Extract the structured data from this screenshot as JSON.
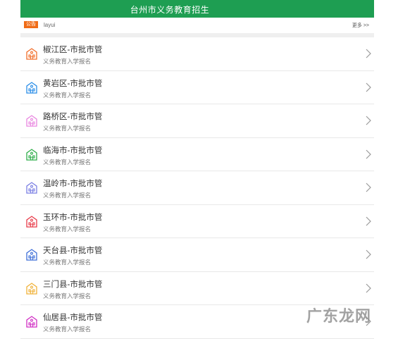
{
  "header": {
    "title": "台州市义务教育招生"
  },
  "notice": {
    "tag": "公告",
    "text": "layui",
    "more": "更多 >>"
  },
  "items": [
    {
      "name": "椒江区-市批市管",
      "sub": "义务教育入学报名",
      "color": "#f26f2b"
    },
    {
      "name": "黄岩区-市批市管",
      "sub": "义务教育入学报名",
      "color": "#2b8ee8"
    },
    {
      "name": "路桥区-市批市管",
      "sub": "义务教育入学报名",
      "color": "#e987e0"
    },
    {
      "name": "临海市-市批市管",
      "sub": "义务教育入学报名",
      "color": "#2fae4a"
    },
    {
      "name": "温岭市-市批市管",
      "sub": "义务教育入学报名",
      "color": "#7b7fe3"
    },
    {
      "name": "玉环市-市批市管",
      "sub": "义务教育入学报名",
      "color": "#e83c4a"
    },
    {
      "name": "天台县-市批市管",
      "sub": "义务教育入学报名",
      "color": "#3e6fd8"
    },
    {
      "name": "三门县-市批市管",
      "sub": "义务教育入学报名",
      "color": "#f0b23a"
    },
    {
      "name": "仙居县-市批市管",
      "sub": "义务教育入学报名",
      "color": "#d12fc4"
    }
  ],
  "watermark": {
    "text": "广东龙网"
  },
  "icons": {
    "item_icon": "school-building-icon",
    "arrow_icon": "chevron-right-icon"
  }
}
